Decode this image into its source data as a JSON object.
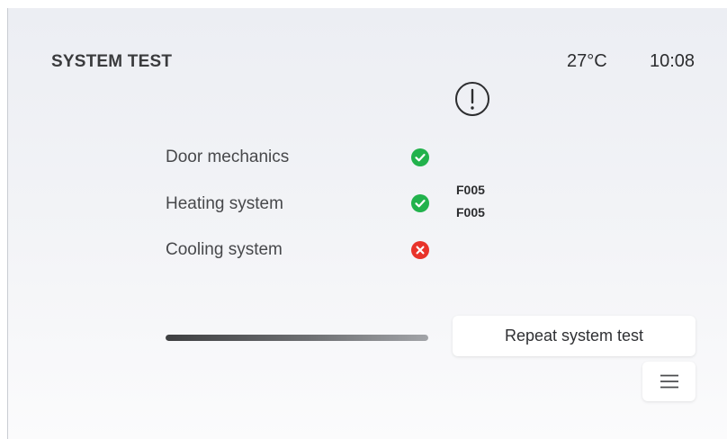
{
  "header": {
    "title": "SYSTEM TEST",
    "temperature": "27°C",
    "time": "10:08",
    "alert_icon": "exclamation-circle-icon"
  },
  "tests": [
    {
      "label": "Door mechanics",
      "status": "pass",
      "icon": "check-circle-icon",
      "color": "#22b24c"
    },
    {
      "label": "Heating system",
      "status": "pass",
      "icon": "check-circle-icon",
      "color": "#22b24c"
    },
    {
      "label": "Cooling system",
      "status": "fail",
      "icon": "x-circle-icon",
      "color": "#e8332a"
    }
  ],
  "error_codes": [
    "F005",
    "F005"
  ],
  "progress": {
    "fraction": 1.0
  },
  "actions": {
    "repeat_label": "Repeat system test",
    "menu_icon": "hamburger-menu-icon"
  }
}
